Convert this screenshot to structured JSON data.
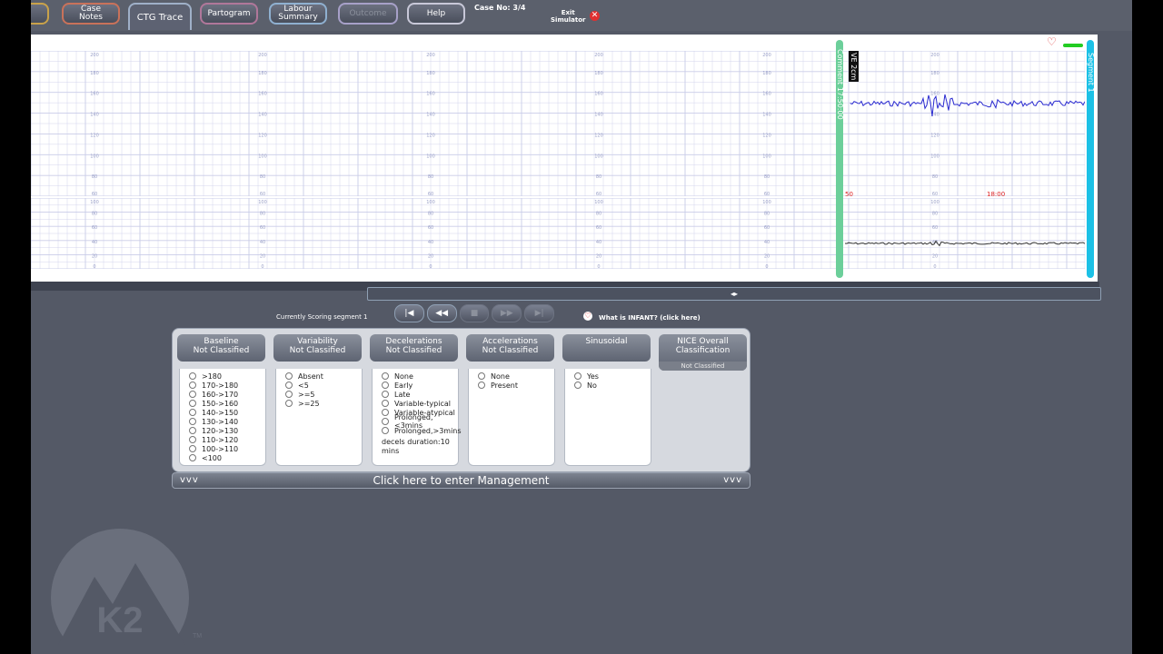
{
  "tabs": [
    {
      "label": "Case\nNotes",
      "state": "normal"
    },
    {
      "label": "CTG Trace",
      "state": "active"
    },
    {
      "label": "Partogram",
      "state": "normal"
    },
    {
      "label": "Labour\nSummary",
      "state": "normal"
    },
    {
      "label": "Outcome",
      "state": "disabled"
    },
    {
      "label": "Help",
      "state": "normal"
    }
  ],
  "case_no": "Case No: 3/4",
  "exit_label": "Exit\nSimulator",
  "trace": {
    "ve_label": "VE 2cm",
    "time_left": "50",
    "time_right": "18:00",
    "green_bar_text": "Comment    17:50:00",
    "blue_bar_text": "Segment 1",
    "fhr_ticks": [
      "200",
      "180",
      "160",
      "140",
      "120",
      "100",
      "80",
      "60"
    ],
    "toco_ticks": [
      "100",
      "80",
      "60",
      "40",
      "20",
      "0"
    ],
    "scroll_indicator": "◂▸"
  },
  "scoring": {
    "status": "Currently Scoring segment 1",
    "infant_link": "What is INFANT? (click here)",
    "controls": [
      "|◀",
      "◀◀",
      "■",
      "▶▶",
      "▶|"
    ]
  },
  "panel": {
    "columns": [
      {
        "title": "Baseline",
        "value": "Not Classified",
        "options": [
          ">180",
          "170->180",
          "160->170",
          "150->160",
          "140->150",
          "130->140",
          "120->130",
          "110->120",
          "100->110",
          "<100"
        ]
      },
      {
        "title": "Variability",
        "value": "Not Classified",
        "options": [
          "Absent",
          "<5",
          ">=5",
          ">=25"
        ]
      },
      {
        "title": "Decelerations",
        "value": "Not Classified",
        "options": [
          "None",
          "Early",
          "Late",
          "Variable-typical",
          "Variable-atypical",
          "Prolonged,<3mins",
          "Prolonged,>3mins"
        ],
        "note": "decels duration:10 mins"
      },
      {
        "title": "Accelerations",
        "value": "Not Classified",
        "options": [
          "None",
          "Present"
        ]
      },
      {
        "title": "Sinusoidal",
        "value": "",
        "options": [
          "Yes",
          "No"
        ]
      },
      {
        "title": "NICE Overall Classification",
        "value": "",
        "badge": "Not Classified",
        "options": []
      }
    ],
    "management": "Click here to enter Management",
    "chevrons": "vvv"
  },
  "colors": {
    "accent_green": "#6ccf9a",
    "accent_blue": "#1cc1e6",
    "trace_blue": "#2a2ad0",
    "grid": "#c9cce8"
  }
}
